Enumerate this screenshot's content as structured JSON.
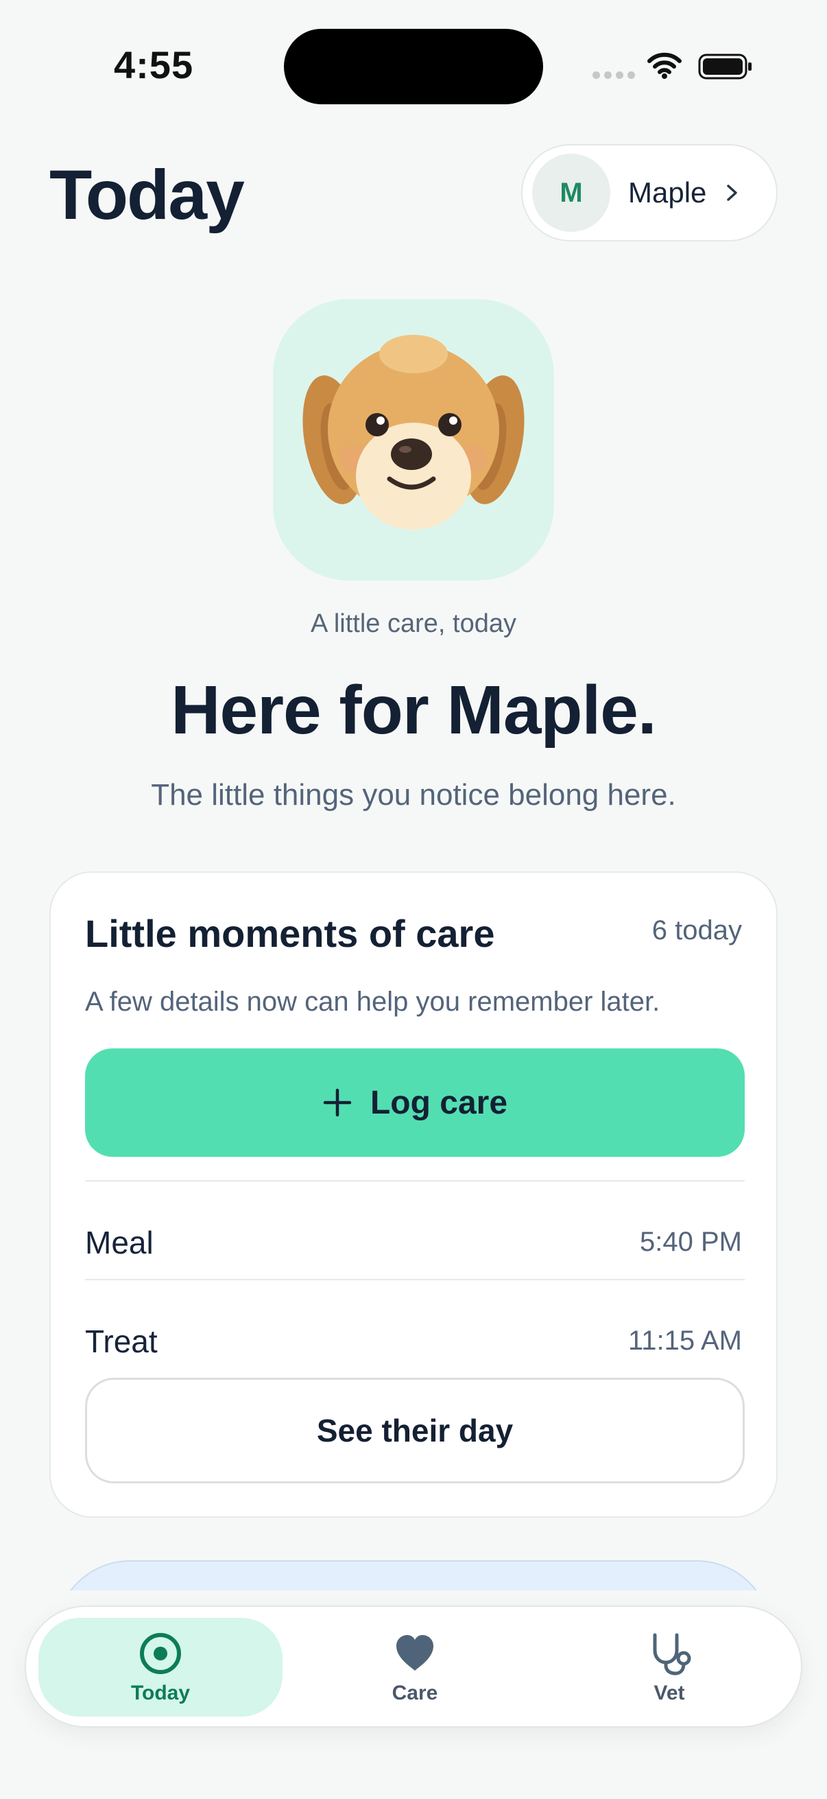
{
  "status_bar": {
    "time": "4:55"
  },
  "header": {
    "title": "Today",
    "pet_chip": {
      "initial": "M",
      "name": "Maple"
    }
  },
  "hero": {
    "eyebrow": "A little care, today",
    "heading": "Here for Maple.",
    "subtitle": "The little things you notice belong here."
  },
  "care_card": {
    "title": "Little moments of care",
    "count": "6 today",
    "description": "A few details now can help you remember later.",
    "log_button": "Log care",
    "entries": [
      {
        "label": "Meal",
        "time": "5:40 PM"
      },
      {
        "label": "Treat",
        "time": "11:15 AM"
      }
    ],
    "see_day_button": "See their day"
  },
  "tab_bar": {
    "tabs": [
      {
        "label": "Today",
        "icon": "target-icon",
        "active": true
      },
      {
        "label": "Care",
        "icon": "heart-icon",
        "active": false
      },
      {
        "label": "Vet",
        "icon": "stethoscope-icon",
        "active": false
      }
    ]
  },
  "colors": {
    "accent": "#53deb2",
    "accent_soft": "#d5f6ea",
    "active_tab_text": "#0d7c59",
    "background": "#f6f8f7"
  }
}
